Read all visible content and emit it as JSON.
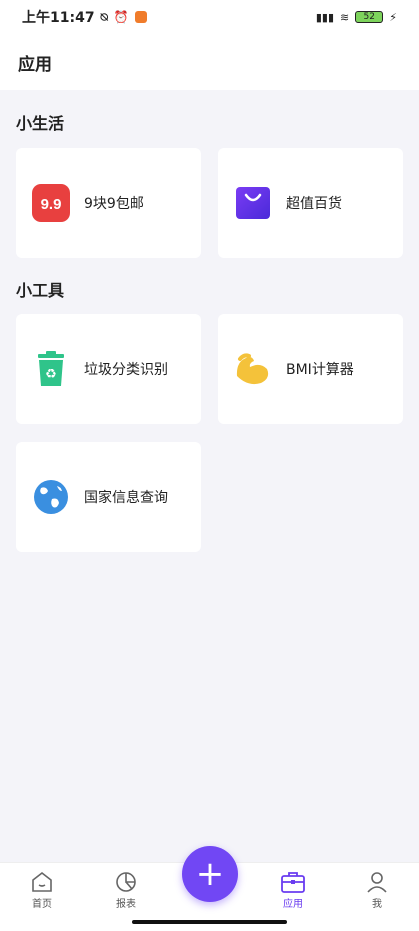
{
  "status_bar": {
    "time": "上午11:47",
    "battery": "52"
  },
  "header": {
    "title": "应用"
  },
  "sections": [
    {
      "title": "小生活",
      "items": [
        {
          "label": "9块9包邮",
          "icon": "nine-nine-icon",
          "badge": "9.9"
        },
        {
          "label": "超值百货",
          "icon": "shopping-bag-icon"
        }
      ]
    },
    {
      "title": "小工具",
      "items": [
        {
          "label": "垃圾分类识别",
          "icon": "recycle-bin-icon"
        },
        {
          "label": "BMI计算器",
          "icon": "muscle-arm-icon"
        },
        {
          "label": "国家信息查询",
          "icon": "globe-icon"
        }
      ]
    }
  ],
  "tabbar": {
    "items": [
      {
        "label": "首页"
      },
      {
        "label": "报表"
      },
      {
        "label": "应用"
      },
      {
        "label": "我"
      }
    ],
    "fab": "+"
  },
  "colors": {
    "accent": "#6a3cf0",
    "fab": "#7147f4"
  }
}
